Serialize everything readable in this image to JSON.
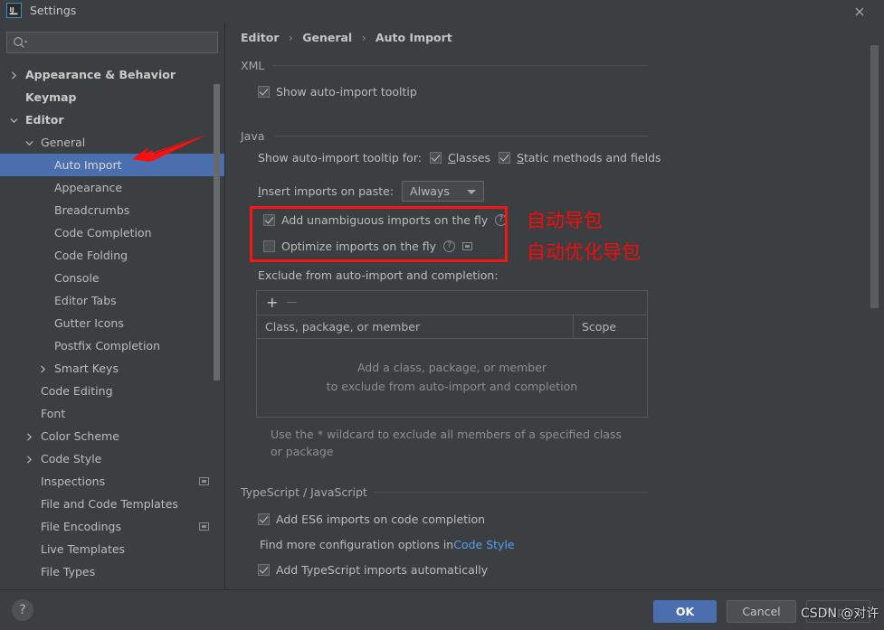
{
  "window": {
    "title": "Settings",
    "icon": "intellij-idea-icon",
    "close_icon": "close-icon"
  },
  "sidebar": {
    "search": {
      "placeholder": "",
      "value": "",
      "icon": "search-icon"
    },
    "items": [
      {
        "label": "Appearance & Behavior",
        "indent": 28,
        "arrow": "chevron-right",
        "bold": true,
        "selected": false,
        "badge": false
      },
      {
        "label": "Keymap",
        "indent": 28,
        "arrow": "none",
        "bold": true,
        "selected": false,
        "badge": false
      },
      {
        "label": "Editor",
        "indent": 28,
        "arrow": "chevron-down",
        "bold": true,
        "selected": false,
        "badge": false
      },
      {
        "label": "General",
        "indent": 45,
        "arrow": "chevron-down",
        "bold": false,
        "selected": false,
        "badge": false
      },
      {
        "label": "Auto Import",
        "indent": 60,
        "arrow": "none",
        "bold": false,
        "selected": true,
        "badge": false
      },
      {
        "label": "Appearance",
        "indent": 60,
        "arrow": "none",
        "bold": false,
        "selected": false,
        "badge": false
      },
      {
        "label": "Breadcrumbs",
        "indent": 60,
        "arrow": "none",
        "bold": false,
        "selected": false,
        "badge": false
      },
      {
        "label": "Code Completion",
        "indent": 60,
        "arrow": "none",
        "bold": false,
        "selected": false,
        "badge": false
      },
      {
        "label": "Code Folding",
        "indent": 60,
        "arrow": "none",
        "bold": false,
        "selected": false,
        "badge": false
      },
      {
        "label": "Console",
        "indent": 60,
        "arrow": "none",
        "bold": false,
        "selected": false,
        "badge": false
      },
      {
        "label": "Editor Tabs",
        "indent": 60,
        "arrow": "none",
        "bold": false,
        "selected": false,
        "badge": false
      },
      {
        "label": "Gutter Icons",
        "indent": 60,
        "arrow": "none",
        "bold": false,
        "selected": false,
        "badge": false
      },
      {
        "label": "Postfix Completion",
        "indent": 60,
        "arrow": "none",
        "bold": false,
        "selected": false,
        "badge": false
      },
      {
        "label": "Smart Keys",
        "indent": 60,
        "arrow": "chevron-right",
        "bold": false,
        "selected": false,
        "badge": false
      },
      {
        "label": "Code Editing",
        "indent": 45,
        "arrow": "none",
        "bold": false,
        "selected": false,
        "badge": false
      },
      {
        "label": "Font",
        "indent": 45,
        "arrow": "none",
        "bold": false,
        "selected": false,
        "badge": false
      },
      {
        "label": "Color Scheme",
        "indent": 45,
        "arrow": "chevron-right",
        "bold": false,
        "selected": false,
        "badge": false
      },
      {
        "label": "Code Style",
        "indent": 45,
        "arrow": "chevron-right",
        "bold": false,
        "selected": false,
        "badge": false
      },
      {
        "label": "Inspections",
        "indent": 45,
        "arrow": "none",
        "bold": false,
        "selected": false,
        "badge": true
      },
      {
        "label": "File and Code Templates",
        "indent": 45,
        "arrow": "none",
        "bold": false,
        "selected": false,
        "badge": false
      },
      {
        "label": "File Encodings",
        "indent": 45,
        "arrow": "none",
        "bold": false,
        "selected": false,
        "badge": true
      },
      {
        "label": "Live Templates",
        "indent": 45,
        "arrow": "none",
        "bold": false,
        "selected": false,
        "badge": false
      },
      {
        "label": "File Types",
        "indent": 45,
        "arrow": "none",
        "bold": false,
        "selected": false,
        "badge": false
      }
    ]
  },
  "main": {
    "breadcrumb": {
      "root": "Editor",
      "mid": "General",
      "leaf": "Auto Import",
      "sep": "›"
    },
    "xml": {
      "section": "XML",
      "show_tooltip_label": "Show auto-import tooltip",
      "show_tooltip_checked": true
    },
    "java": {
      "section": "Java",
      "tooltip_for_label": "Show auto-import tooltip for:",
      "classes_label_mn": "C",
      "classes_label_rest": "lasses",
      "classes_checked": true,
      "static_label_mn": "S",
      "static_label_rest": "tatic methods and fields",
      "static_checked": true,
      "insert_label_mn": "I",
      "insert_label_rest": "nsert imports on paste:",
      "insert_value": "Always",
      "add_unambiguous_label": "Add unambiguous imports on the fly",
      "add_unambiguous_checked": true,
      "optimize_label": "Optimize imports on the fly",
      "optimize_checked": false,
      "exclude_label": "Exclude from auto-import and completion:",
      "table": {
        "add_icon": "plus-icon",
        "remove_icon": "minus-icon",
        "columns": [
          "Class, package, or member",
          "Scope"
        ],
        "empty_line1": "Add a class, package, or member",
        "empty_line2": "to exclude from auto-import and completion",
        "rows": []
      },
      "wildcard_hint": "Use the * wildcard to exclude all members of a specified class or package"
    },
    "tsjs": {
      "section": "TypeScript / JavaScript",
      "es6_label": "Add ES6 imports on code completion",
      "es6_checked": true,
      "find_more_prefix": "Find more configuration options in ",
      "find_more_link": "Code Style",
      "ts_auto_label": "Add TypeScript imports automatically",
      "ts_auto_checked": true
    }
  },
  "annotations": {
    "note1": "自动导包",
    "note2": "自动优化导包",
    "arrow": "red-arrow-pointer",
    "box_color": "#f91414",
    "text_color": "#f60b0b"
  },
  "footer": {
    "help_label": "?",
    "ok_label": "OK",
    "cancel_label": "Cancel",
    "apply_label": "Apply",
    "watermark": "CSDN @对许"
  }
}
